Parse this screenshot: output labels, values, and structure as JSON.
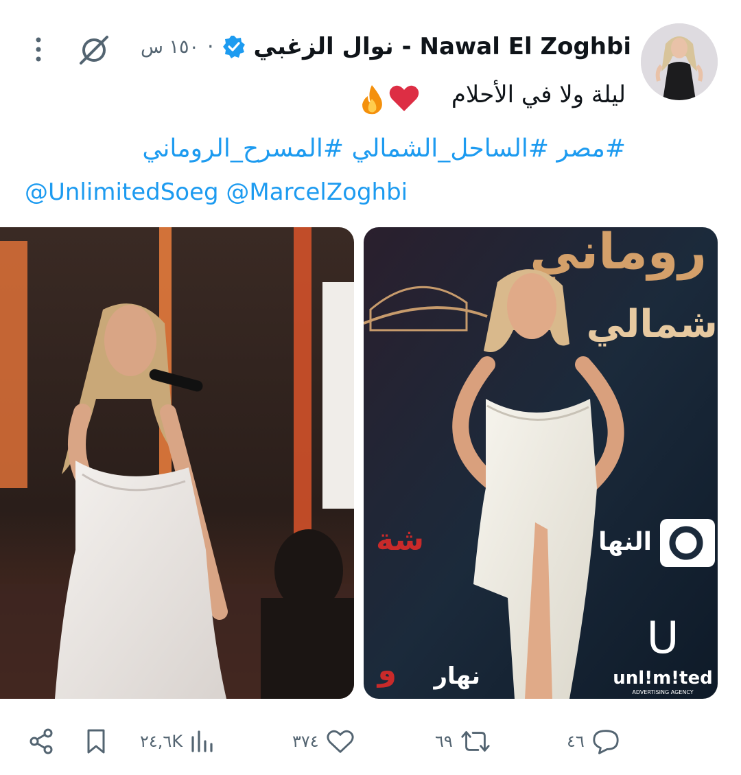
{
  "author": {
    "display_name": "نوال الزغبي - Nawal El Zoghbi",
    "verified": true,
    "timestamp": "١٥٠ س",
    "separator": "·"
  },
  "tweet": {
    "text": "ليلة ولا في الأحلام",
    "emojis": [
      "fire-icon",
      "red-heart-icon"
    ],
    "hashtags": "#مصر #الساحل_الشمالي #المسرح_الروماني",
    "mentions": "@UnlimitedSoeg @MarcelZoghbi"
  },
  "photos": {
    "right_backdrop": {
      "wordmark_top": "روماني",
      "wordmark_mid": "شمالي",
      "sponsor_left": "شة",
      "sponsor_mid": "النها",
      "sponsor_bottom": "نهار",
      "sponsor_partial": "و",
      "logo_letter": "U",
      "logo_brand": "unl!m!ted",
      "logo_tagline": "ADVERTISING AGENCY"
    }
  },
  "actions": {
    "replies": "٤٦",
    "reposts": "٦٩",
    "likes": "٣٧٤",
    "views": "٢٤,٦K"
  },
  "colors": {
    "link": "#1d9bf0",
    "verified": "#1d9bf0",
    "secondary_text": "#536471"
  }
}
